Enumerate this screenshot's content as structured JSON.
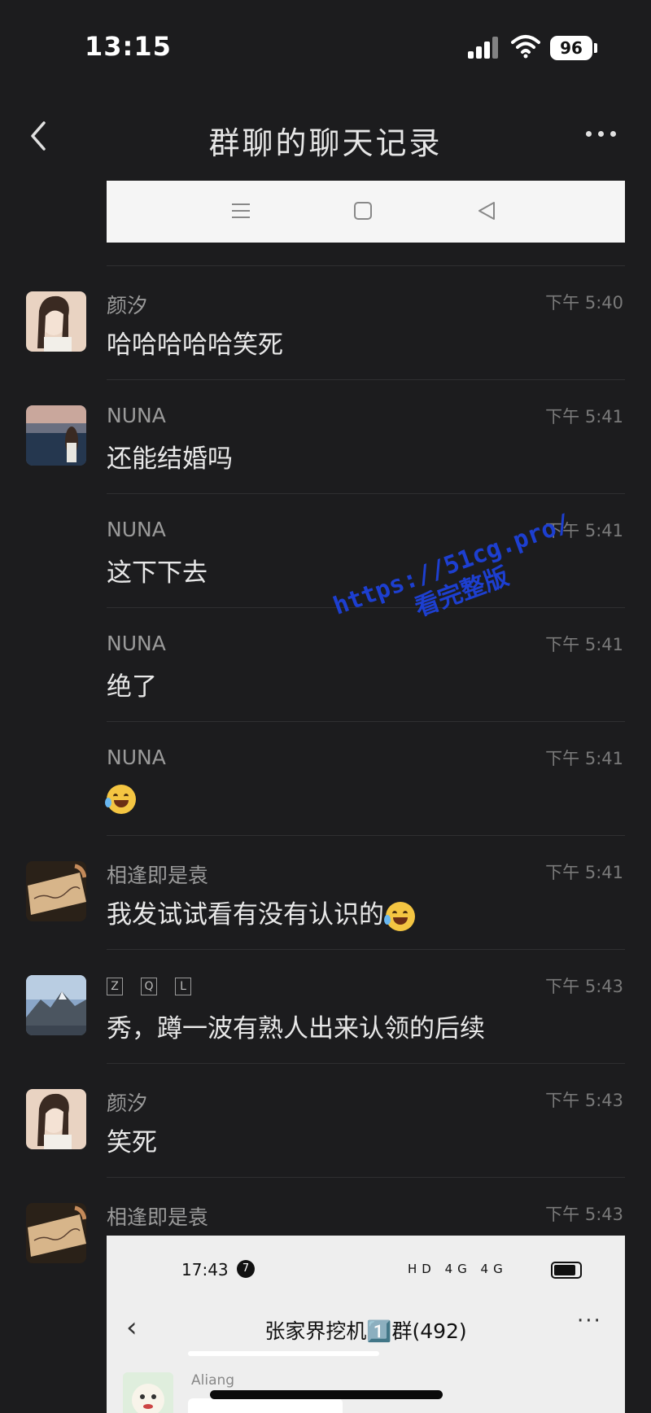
{
  "status_bar": {
    "time": "13:15",
    "battery": "96"
  },
  "nav": {
    "title": "群聊的聊天记录"
  },
  "watermark": {
    "line1": "https://51cg.pro/",
    "line2": "看完整版"
  },
  "messages": [
    {
      "sender": "颜汐",
      "time": "下午 5:40",
      "text": "哈哈哈哈哈笑死",
      "avatar": "girl-portrait"
    },
    {
      "sender": "NUNA",
      "time": "下午 5:41",
      "text": "还能结婚吗",
      "avatar": "lakeside-photo"
    },
    {
      "sender": "NUNA",
      "time": "下午 5:41",
      "text": "这下下去"
    },
    {
      "sender": "NUNA",
      "time": "下午 5:41",
      "text": "绝了"
    },
    {
      "sender": "NUNA",
      "time": "下午 5:41",
      "text": "",
      "emoji": "tears-of-joy"
    },
    {
      "sender": "相逢即是袁",
      "time": "下午 5:41",
      "text": "我发试试看有没有认识的",
      "avatar": "handwriting-card",
      "emoji": "tears-of-joy"
    },
    {
      "sender_letters": [
        "Z",
        "Q",
        "L"
      ],
      "time": "下午 5:43",
      "text": "秀，蹲一波有熟人出来认领的后续",
      "avatar": "mountain-photo"
    },
    {
      "sender": "颜汐",
      "time": "下午 5:43",
      "text": "笑死",
      "avatar": "girl-portrait"
    },
    {
      "sender": "相逢即是袁",
      "time": "下午 5:43",
      "text": "",
      "avatar": "handwriting-card"
    }
  ],
  "embedded_screenshot": {
    "time": "17:43",
    "notification_count": "7",
    "status_icons": "HD 4G 4G",
    "title": "张家界挖机1️⃣群(492)",
    "member_name": "Aliang"
  },
  "colors": {
    "background": "#1c1c1e",
    "watermark": "#1d3fd0",
    "emoji": "#f4c542"
  }
}
